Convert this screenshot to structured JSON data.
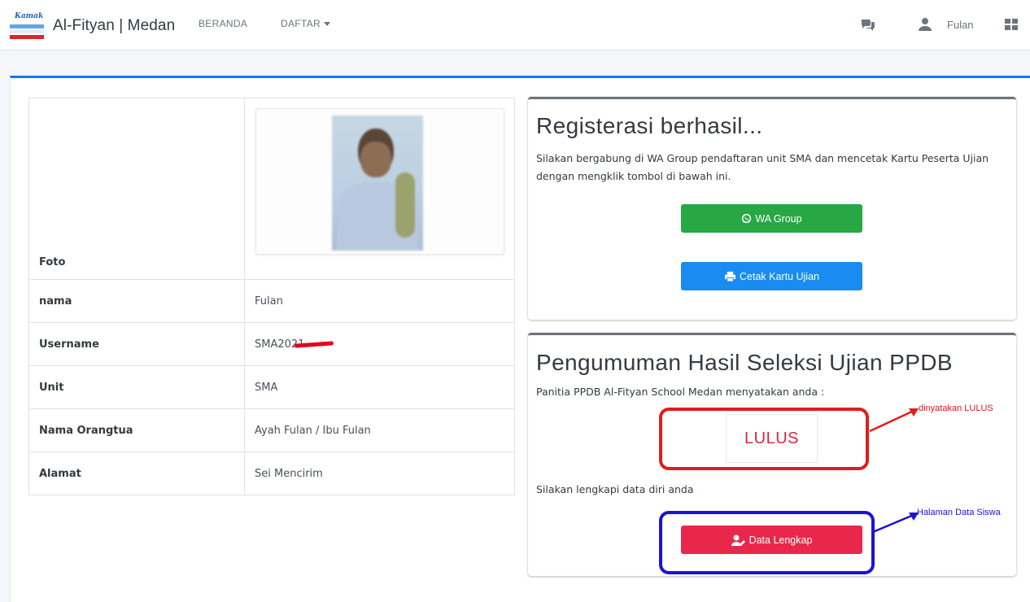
{
  "navbar": {
    "logo_text": "Kamak",
    "brand": "Al-Fityan | Medan",
    "links": [
      "BERANDA",
      "DAFTAR"
    ],
    "user_name": "Fulan"
  },
  "profile": {
    "rows": [
      {
        "label": "Foto",
        "value": ""
      },
      {
        "label": "nama",
        "value": "Fulan"
      },
      {
        "label": "Username",
        "value": "SMA2021"
      },
      {
        "label": "Unit",
        "value": "SMA"
      },
      {
        "label": "Nama Orangtua",
        "value": "Ayah Fulan / Ibu Fulan"
      },
      {
        "label": "Alamat",
        "value": "Sei Mencirim"
      }
    ]
  },
  "registration": {
    "title": "Registerasi berhasil...",
    "description": "Silakan bergabung di WA Group pendaftaran unit SMA dan mencetak Kartu Peserta Ujian dengan mengklik tombol di bawah ini.",
    "wa_button": "WA Group",
    "print_button": "Cetak Kartu Ujian"
  },
  "announcement": {
    "title": "Pengumuman Hasil Seleksi Ujian PPDB",
    "statement": "Panitia PPDB Al-Fityan School Medan menyatakan anda :",
    "result": "LULUS",
    "instruction": "Silakan lengkapi data diri anda",
    "data_button": "Data Lengkap"
  },
  "annotations": {
    "lulus_note": "dinyatakan LULUS",
    "halaman_note": "Halaman Data Siswa"
  },
  "colors": {
    "primary": "#007bff",
    "success": "#28a745",
    "danger": "#e9274b",
    "annotation_red": "#e21c1c",
    "annotation_blue": "#1d12d6"
  }
}
